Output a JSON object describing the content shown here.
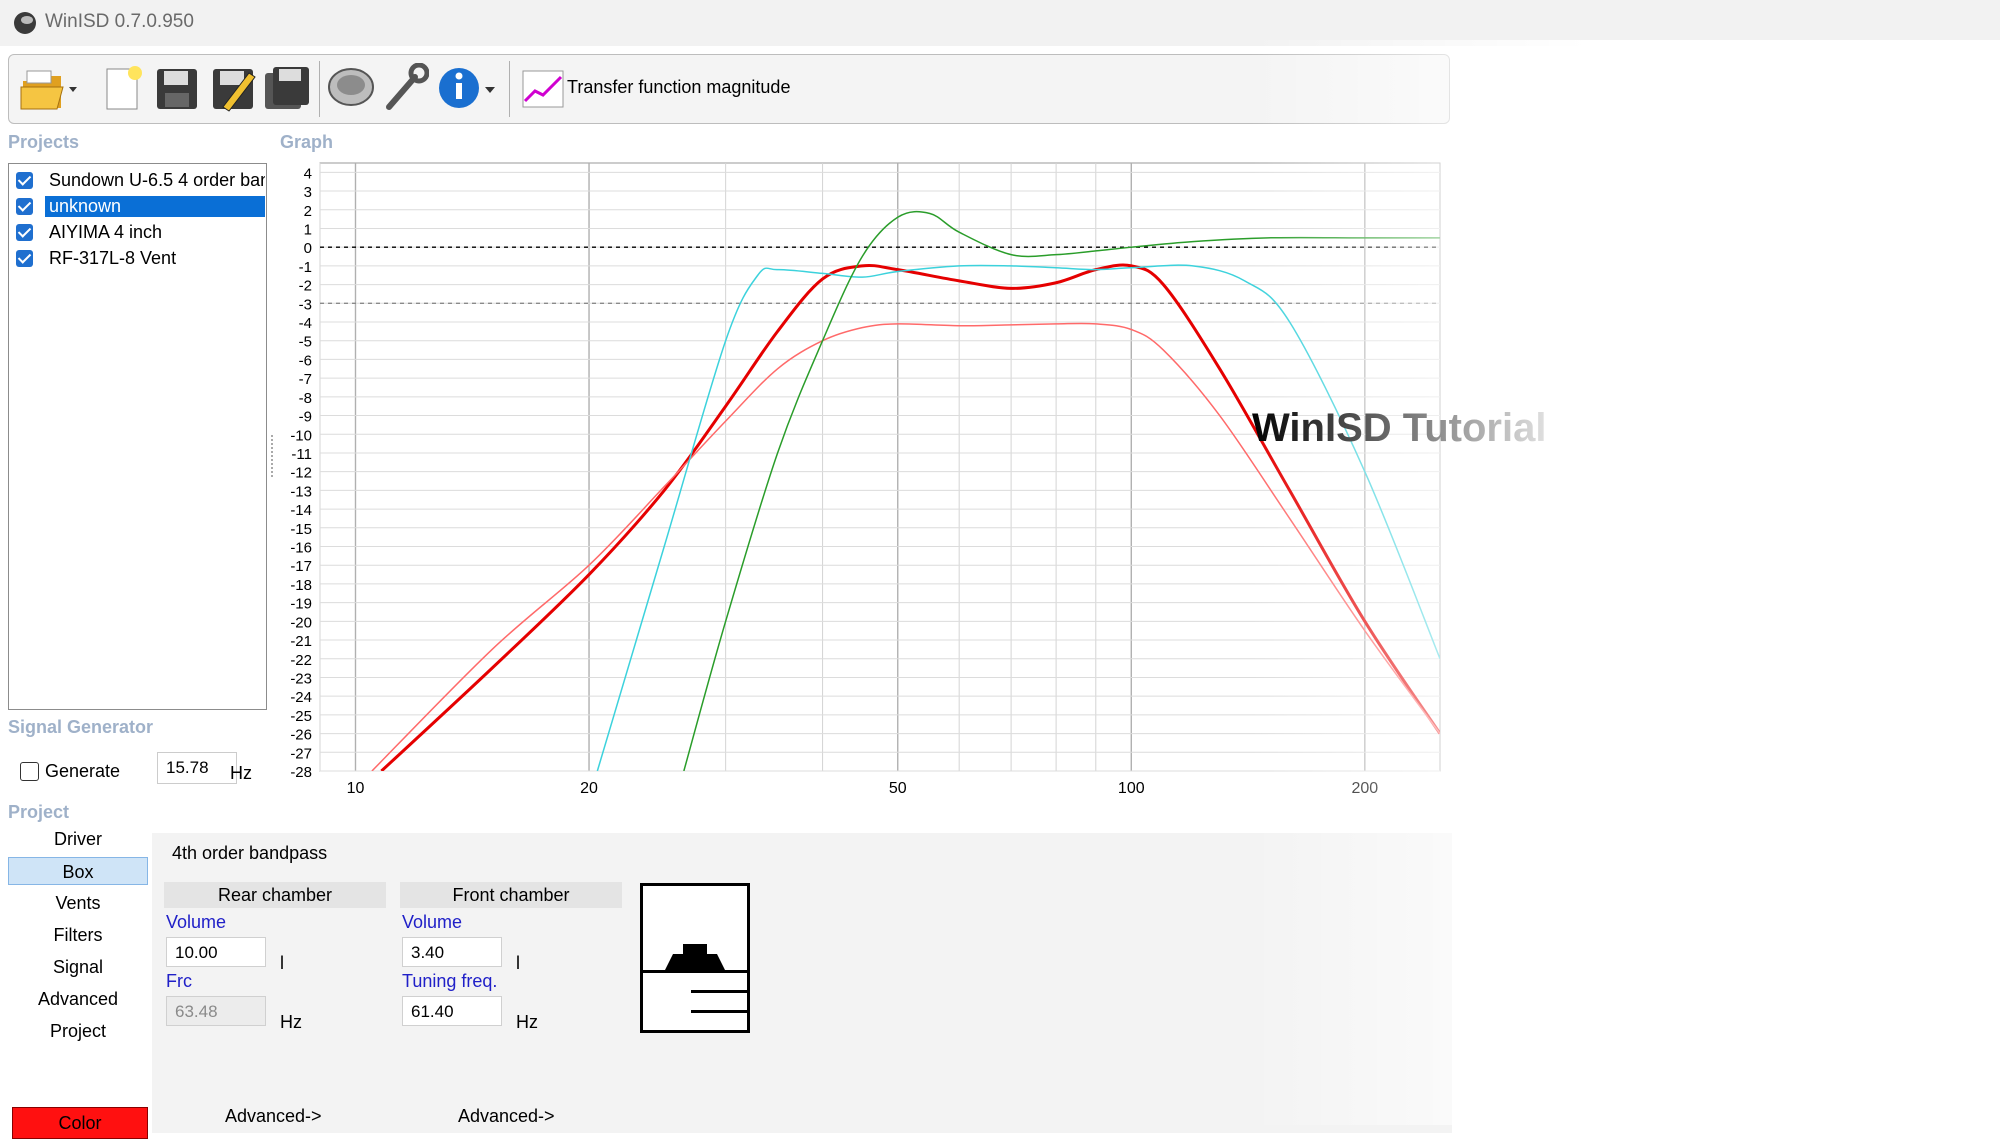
{
  "app": {
    "title": "WinISD 0.7.0.950"
  },
  "toolbar": {
    "graph_selector_label": "Transfer function magnitude"
  },
  "projects": {
    "label": "Projects",
    "items": [
      {
        "label": "Sundown U-6.5 4 order ban",
        "checked": true,
        "selected": false
      },
      {
        "label": "unknown",
        "checked": true,
        "selected": true
      },
      {
        "label": "AIYIMA 4 inch",
        "checked": true,
        "selected": false
      },
      {
        "label": "RF-317L-8 Vent",
        "checked": true,
        "selected": false
      }
    ]
  },
  "graph": {
    "label": "Graph"
  },
  "signal_generator": {
    "label": "Signal Generator",
    "generate_label": "Generate",
    "generate_checked": false,
    "frequency_value": "15.78",
    "frequency_unit": "Hz"
  },
  "project_nav": {
    "label": "Project",
    "items": [
      "Driver",
      "Box",
      "Vents",
      "Filters",
      "Signal",
      "Advanced",
      "Project"
    ],
    "active": "Box",
    "color_label": "Color",
    "color_value": "#ff1010"
  },
  "box": {
    "type": "4th order bandpass",
    "rear": {
      "header": "Rear chamber",
      "volume_label": "Volume",
      "volume_value": "10.00",
      "volume_unit": "l",
      "frc_label": "Frc",
      "frc_value": "63.48",
      "frc_unit": "Hz",
      "advanced_label": "Advanced->"
    },
    "front": {
      "header": "Front chamber",
      "volume_label": "Volume",
      "volume_value": "3.40",
      "volume_unit": "l",
      "tuning_label": "Tuning freq.",
      "tuning_value": "61.40",
      "tuning_unit": "Hz",
      "advanced_label": "Advanced->"
    }
  },
  "watermark": "WinISD Tutorial",
  "chart_data": {
    "type": "line",
    "xscale": "log",
    "xlim": [
      9,
      250
    ],
    "ylim": [
      -28,
      4.5
    ],
    "x_ticks": [
      10,
      20,
      50,
      100,
      200
    ],
    "y_ticks": [
      4,
      3,
      2,
      1,
      0,
      -1,
      -2,
      -3,
      -4,
      -5,
      -6,
      -7,
      -8,
      -9,
      -10,
      -11,
      -12,
      -13,
      -14,
      -15,
      -16,
      -17,
      -18,
      -19,
      -20,
      -21,
      -22,
      -23,
      -24,
      -25,
      -26,
      -27,
      -28
    ],
    "reference_lines": [
      0,
      -3
    ],
    "series": [
      {
        "color": "#e50000",
        "width": 3,
        "x": [
          10.8,
          15,
          20,
          25,
          30,
          35,
          40,
          45,
          50,
          60,
          70,
          80,
          90,
          100,
          110,
          130,
          160,
          200,
          250
        ],
        "y": [
          -28,
          -22.5,
          -17.5,
          -13,
          -8.5,
          -4.5,
          -1.7,
          -1,
          -1.2,
          -1.8,
          -2.2,
          -1.9,
          -1.2,
          -1.0,
          -2,
          -6.5,
          -13,
          -20,
          -26
        ]
      },
      {
        "color": "#ff6a6a",
        "width": 1.5,
        "x": [
          10.5,
          15,
          20,
          25,
          30,
          35,
          40,
          45,
          50,
          60,
          70,
          80,
          90,
          100,
          110,
          130,
          160,
          200,
          250
        ],
        "y": [
          -28,
          -21.5,
          -17,
          -12.8,
          -9.3,
          -6.5,
          -5,
          -4.3,
          -4.1,
          -4.2,
          -4.15,
          -4.1,
          -4.1,
          -4.4,
          -5.5,
          -9,
          -14.5,
          -20.5,
          -26
        ]
      },
      {
        "color": "#3cd2dc",
        "width": 1.5,
        "x": [
          20.5,
          25,
          30,
          33,
          35,
          40,
          45,
          50,
          60,
          70,
          80,
          90,
          100,
          120,
          140,
          160,
          200,
          250
        ],
        "y": [
          -28,
          -16,
          -5,
          -1.5,
          -1.2,
          -1.4,
          -1.6,
          -1.3,
          -1.0,
          -1.0,
          -1.1,
          -1.2,
          -1.1,
          -1.0,
          -1.8,
          -4,
          -12,
          -22
        ]
      },
      {
        "color": "#2a9d2a",
        "width": 1.5,
        "x": [
          26.5,
          30,
          35,
          40,
          45,
          50,
          55,
          60,
          70,
          80,
          90,
          100,
          120,
          150,
          200,
          250
        ],
        "y": [
          -28,
          -20,
          -11,
          -5,
          -0.5,
          1.6,
          1.8,
          0.8,
          -0.4,
          -0.4,
          -0.2,
          0.0,
          0.3,
          0.5,
          0.5,
          0.5
        ]
      }
    ]
  }
}
